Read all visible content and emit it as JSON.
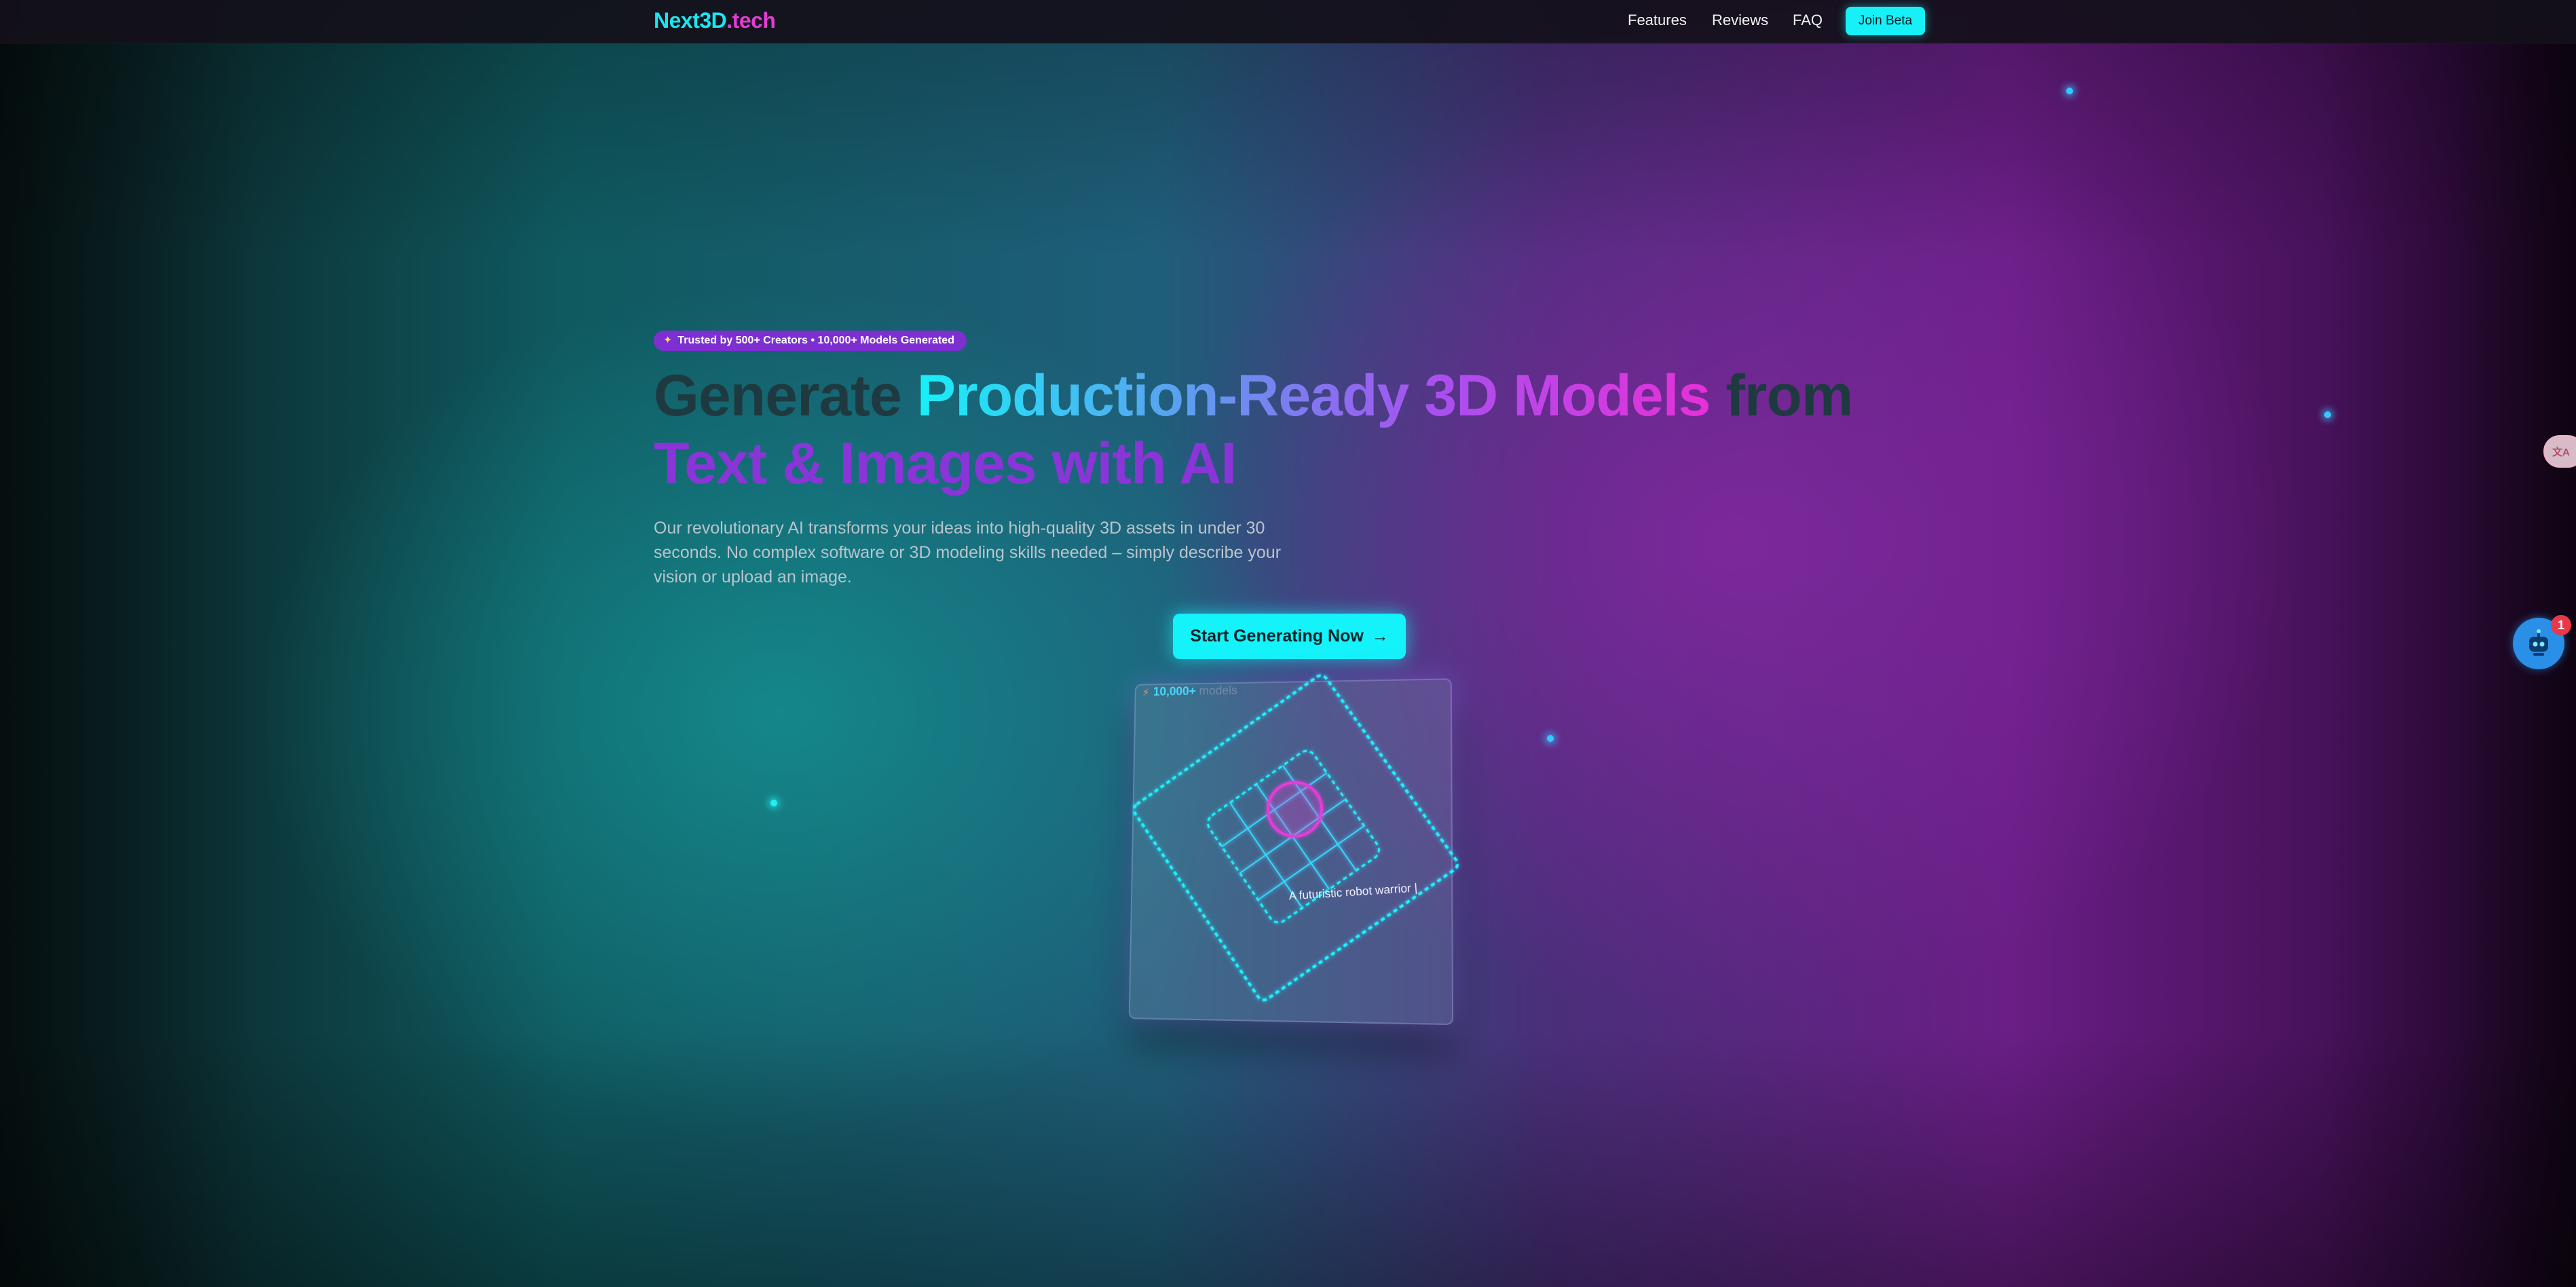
{
  "nav": {
    "logo_main": "Next3D",
    "logo_suffix": ".tech",
    "links": [
      "Features",
      "Reviews",
      "FAQ"
    ],
    "cta_label": "Join Beta"
  },
  "hero": {
    "badge_icon": "rocket-icon",
    "badge_text": "Trusted by 500+ Creators • 10,000+ Models Generated",
    "headline": {
      "part1": "Generate ",
      "part2": "Production-Ready 3D Models",
      "part3": " from",
      "line2": "Text & Images with AI"
    },
    "description": "Our revolutionary AI transforms your ideas into high-quality 3D assets in under 30 seconds. No complex software or 3D modeling skills needed – simply describe your vision or upload an image.",
    "cta_label": "Start Generating Now",
    "cta_icon": "arrow-right-icon"
  },
  "preview_card": {
    "stat_icon": "lightning-icon",
    "stat_value": "10,000+",
    "stat_label_faint": "models",
    "prompt_text": "A futuristic robot warrior"
  },
  "widgets": {
    "translate_icon": "translate-icon",
    "help_icon": "robot-assistant-icon",
    "help_badge_count": "1"
  },
  "colors": {
    "accent_cyan": "#14f2fa",
    "accent_magenta": "#e33cd2",
    "accent_purple": "#8a35d8"
  }
}
